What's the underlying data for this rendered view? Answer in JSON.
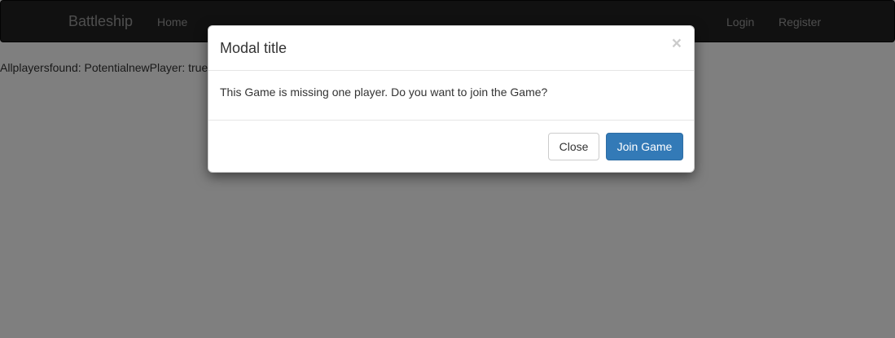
{
  "navbar": {
    "brand": "Battleship",
    "home": "Home",
    "login": "Login",
    "register": "Register"
  },
  "content": {
    "text": "Allplayersfound: PotentialnewPlayer: true"
  },
  "modal": {
    "title": "Modal title",
    "close_symbol": "×",
    "body": "This Game is missing one player. Do you want to join the Game?",
    "close_button": "Close",
    "join_button": "Join Game"
  },
  "colors": {
    "navbar_bg": "#222222",
    "nav_text": "#9d9d9d",
    "primary": "#337ab7"
  }
}
